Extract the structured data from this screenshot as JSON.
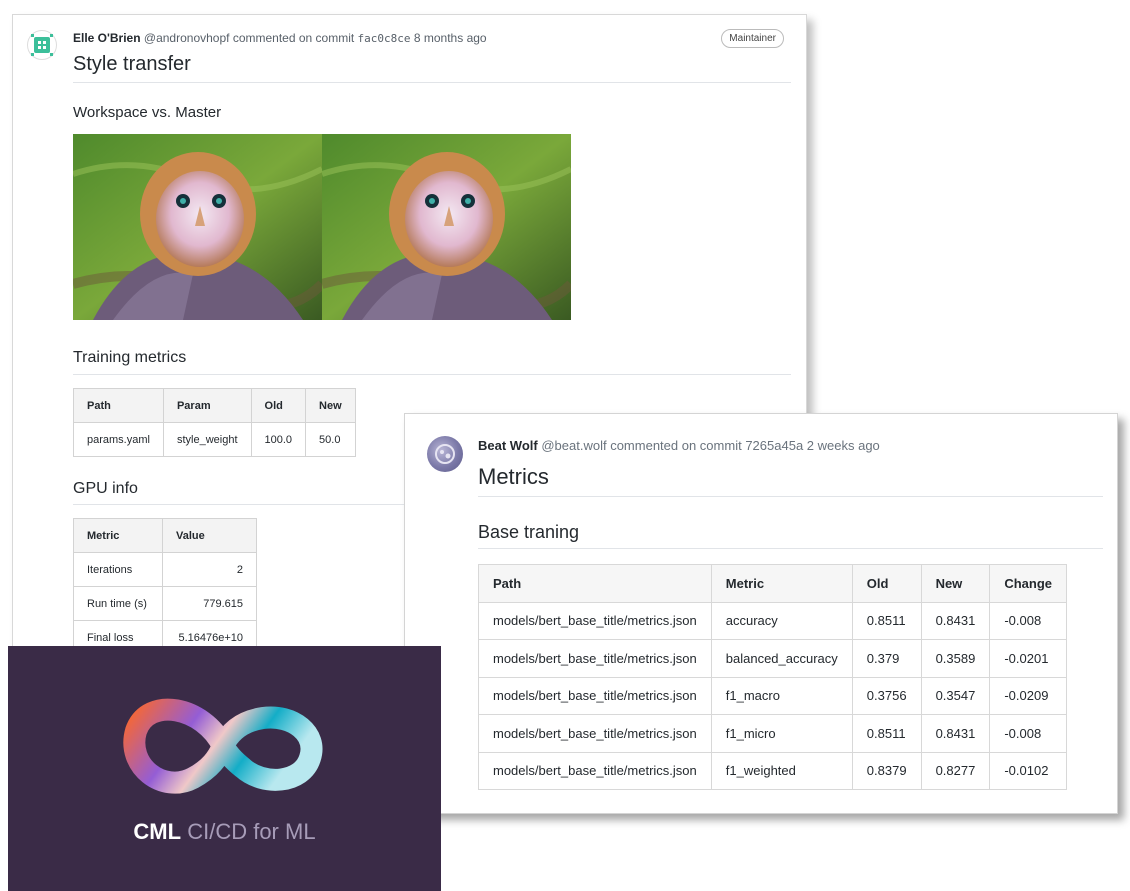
{
  "card1": {
    "author": "Elle O'Brien",
    "handle": "@andronovhopf",
    "action": "commented on commit",
    "commit": "fac0c8ce",
    "time": "8 months ago",
    "badge": "Maintainer",
    "title": "Style transfer",
    "section_images": "Workspace vs. Master",
    "section_training": "Training metrics",
    "training_table": {
      "headers": [
        "Path",
        "Param",
        "Old",
        "New"
      ],
      "rows": [
        [
          "params.yaml",
          "style_weight",
          "100.0",
          "50.0"
        ]
      ]
    },
    "section_gpu": "GPU info",
    "gpu_table": {
      "headers": [
        "Metric",
        "Value"
      ],
      "rows": [
        [
          "Iterations",
          "2"
        ],
        [
          "Run time (s)",
          "779.615"
        ],
        [
          "Final loss",
          "5.16476e+10"
        ]
      ]
    }
  },
  "card2": {
    "author": "Beat Wolf",
    "handle": "@beat.wolf",
    "action": "commented on commit",
    "commit": "7265a45a",
    "time": "2 weeks ago",
    "title": "Metrics",
    "section": "Base traning",
    "table": {
      "headers": [
        "Path",
        "Metric",
        "Old",
        "New",
        "Change"
      ],
      "rows": [
        [
          "models/bert_base_title/metrics.json",
          "accuracy",
          "0.8511",
          "0.8431",
          "-0.008"
        ],
        [
          "models/bert_base_title/metrics.json",
          "balanced_accuracy",
          "0.379",
          "0.3589",
          "-0.0201"
        ],
        [
          "models/bert_base_title/metrics.json",
          "f1_macro",
          "0.3756",
          "0.3547",
          "-0.0209"
        ],
        [
          "models/bert_base_title/metrics.json",
          "f1_micro",
          "0.8511",
          "0.8431",
          "-0.008"
        ],
        [
          "models/bert_base_title/metrics.json",
          "f1_weighted",
          "0.8379",
          "0.8277",
          "-0.0102"
        ]
      ]
    }
  },
  "cml": {
    "brand": "CML",
    "tagline": "CI/CD for ML",
    "colors": {
      "bg": "#3a2b47",
      "orange": "#f46737",
      "purple": "#945dd5",
      "teal": "#13adc7"
    }
  },
  "icons": {
    "avatar1": "robot-avatar-icon",
    "avatar2": "user-avatar-icon",
    "logo": "infinity-logo-icon"
  }
}
